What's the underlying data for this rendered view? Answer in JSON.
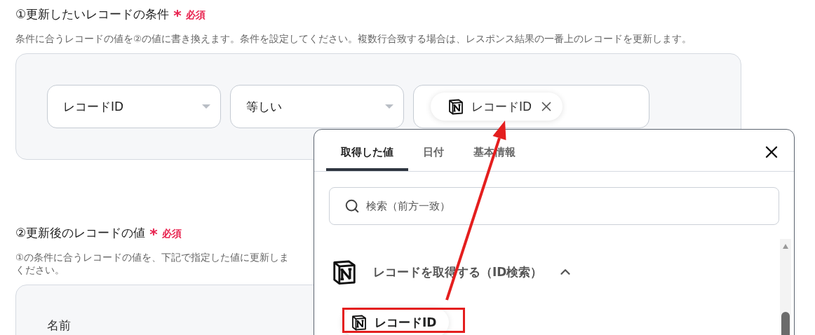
{
  "sections": [
    {
      "kind": "conditions",
      "title": "①更新したいレコードの条件",
      "required_mark": "*",
      "required_label": "必須",
      "description_lines": [
        "条件に合うレコードの値を②の値に書き換えます。条件を設定してください。複数行合致する場合は、レスポンス結果の一番上のレコードを更新します。"
      ],
      "condition": {
        "field": "レコードID",
        "operator": "等しい",
        "value_chip": "レコードID"
      }
    },
    {
      "kind": "values",
      "title": "②更新後のレコードの値",
      "required_mark": "*",
      "required_label": "必須",
      "description_lines": [
        "①の条件に合うレコードの値を、下記で指定した値に更新しま",
        "ください。"
      ],
      "field_label": "名前"
    }
  ],
  "picker": {
    "tabs": [
      {
        "label": "取得した値",
        "selected": true
      },
      {
        "label": "日付",
        "selected": false
      },
      {
        "label": "基本情報",
        "selected": false
      }
    ],
    "search": {
      "placeholder": "検索（前方一致）"
    },
    "groups": [
      {
        "title": "レコードを取得する（ID検索）",
        "expanded": true,
        "items": [
          {
            "label": "レコードID",
            "highlighted": true
          }
        ]
      }
    ]
  }
}
